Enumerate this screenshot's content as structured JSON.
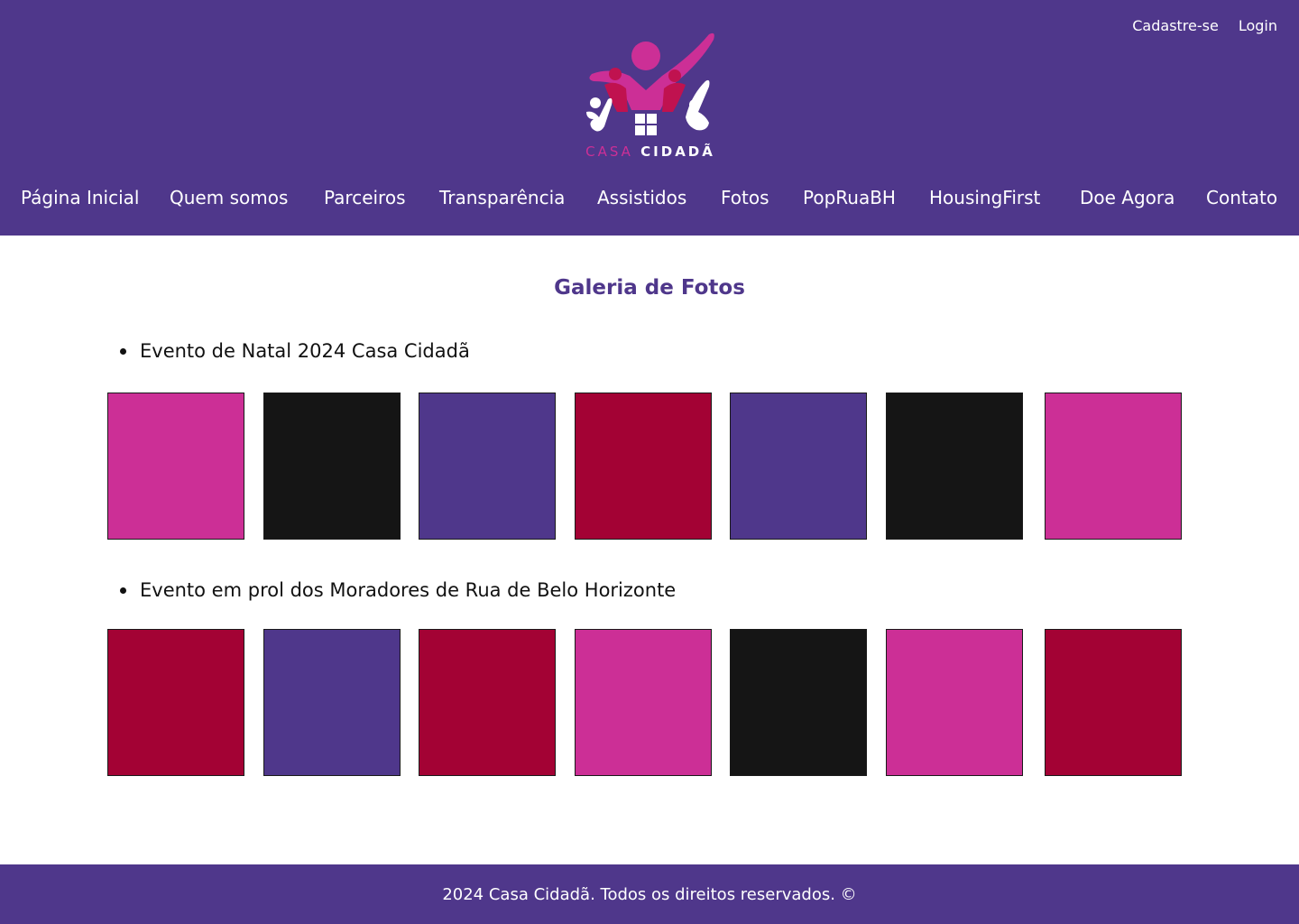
{
  "header": {
    "auth": {
      "signup_label": "Cadastre-se",
      "login_label": "Login"
    },
    "logo": {
      "word1": "CASA",
      "word2": "CIDADÃ",
      "colors": {
        "magenta": "#cc2f96",
        "crimson": "#c0124f",
        "white": "#ffffff"
      }
    },
    "nav": [
      {
        "label": "Página Inicial"
      },
      {
        "label": "Quem somos"
      },
      {
        "label": "Parceiros"
      },
      {
        "label": "Transparência"
      },
      {
        "label": "Assistidos"
      },
      {
        "label": "Fotos"
      },
      {
        "label": "PopRuaBH"
      },
      {
        "label": "HousingFirst"
      },
      {
        "label": "Doe Agora"
      },
      {
        "label": "Contato"
      }
    ]
  },
  "main": {
    "title": "Galeria de Fotos",
    "events": [
      {
        "label": "Evento de Natal 2024 Casa Cidadã",
        "photos": [
          "#cc2f96",
          "#151515",
          "#4f378b",
          "#a30234",
          "#4f378b",
          "#151515",
          "#cc2f96"
        ]
      },
      {
        "label": "Evento em prol dos Moradores de Rua de Belo Horizonte",
        "photos": [
          "#a30234",
          "#4f378b",
          "#a30234",
          "#cc2f96",
          "#151515",
          "#cc2f96",
          "#a30234"
        ]
      }
    ]
  },
  "footer": {
    "text": "2024 Casa Cidadã. Todos os direitos reservados. ©"
  },
  "colors": {
    "brand_purple": "#4f378b",
    "magenta": "#cc2f96",
    "crimson": "#a30234",
    "dark": "#151515"
  }
}
